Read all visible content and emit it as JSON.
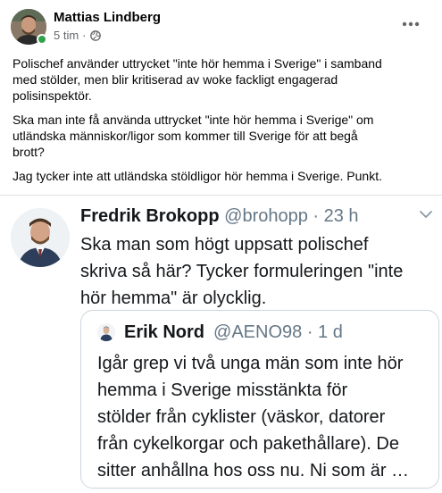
{
  "post": {
    "author": "Mattias Lindberg",
    "time": "5 tim",
    "separator": "·",
    "paragraphs": [
      [
        "Polischef använder uttrycket \"inte hör hemma i Sverige\" i samband",
        "med stölder, men blir kritiserad av woke fackligt engagerad",
        "polisinspektör."
      ],
      [
        "Ska man inte få använda uttrycket \"inte hör hemma i Sverige\" om",
        "utländska människor/ligor som kommer till Sverige för att begå",
        "brott?"
      ],
      [
        "Jag tycker inte att utländska stöldligor hör hemma i Sverige. Punkt."
      ]
    ],
    "icons": {
      "privacy": "globe-icon",
      "more": "more-horizontal-icon"
    },
    "online_color": "#31a24c"
  },
  "tweet": {
    "name": "Fredrik Brokopp",
    "handle": "@brohopp",
    "time": "· 23 h",
    "lines": [
      "Ska man som högt uppsatt polischef",
      "skriva så här? Tycker formuleringen \"inte",
      "hör hemma\" är olycklig."
    ],
    "icons": {
      "menu": "chevron-down-icon"
    },
    "quote": {
      "name": "Erik Nord",
      "handle": "@AENO98",
      "time": "· 1 d",
      "lines": [
        "Igår grep vi två unga män som inte hör",
        "hemma i Sverige misstänkta för",
        "stölder från cyklister (väskor, datorer",
        "från cykelkorgar och pakethållare). De",
        "sitter anhållna hos oss nu. Ni som är …"
      ]
    }
  }
}
